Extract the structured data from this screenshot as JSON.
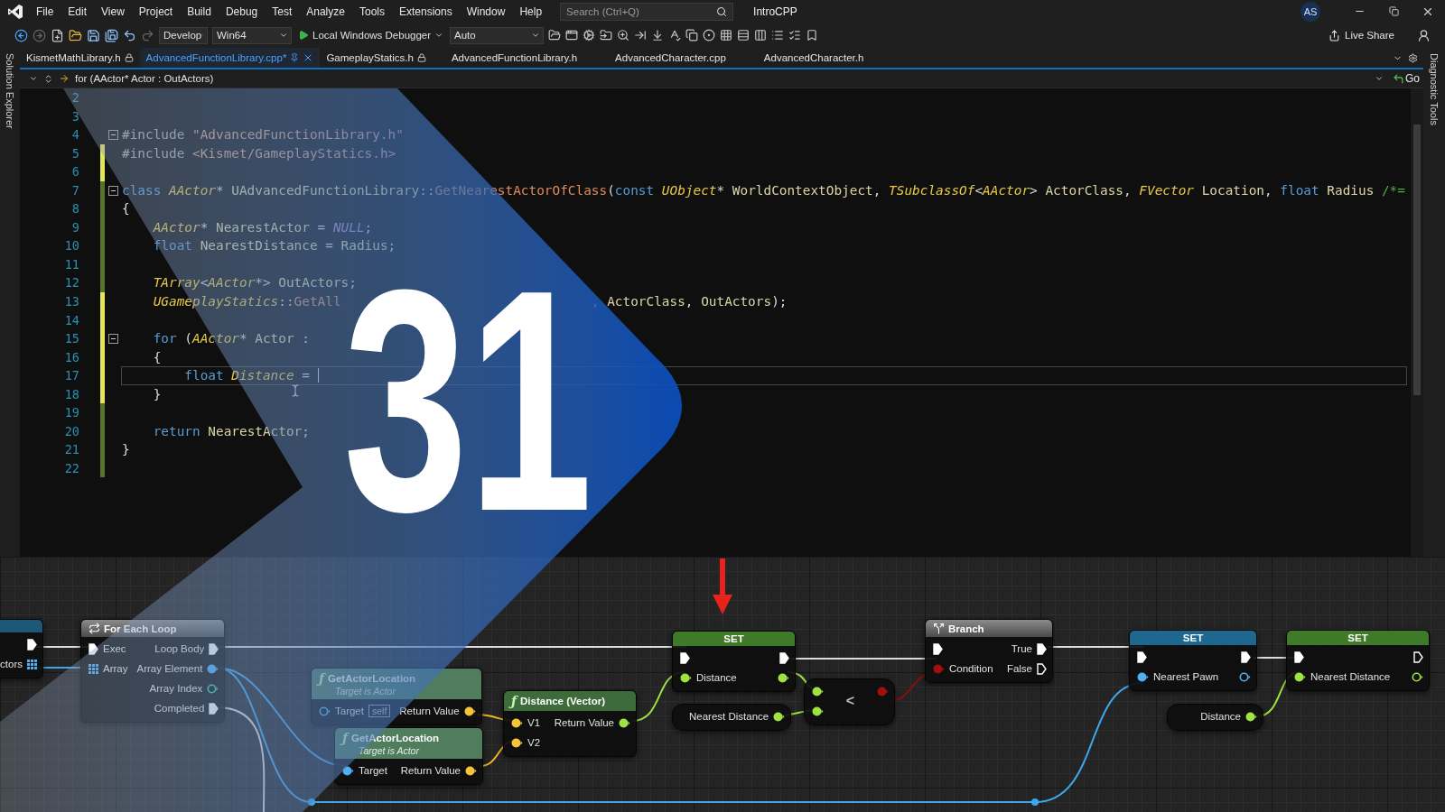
{
  "menu": [
    "File",
    "Edit",
    "View",
    "Project",
    "Build",
    "Debug",
    "Test",
    "Analyze",
    "Tools",
    "Extensions",
    "Window",
    "Help"
  ],
  "search": {
    "placeholder": "Search (Ctrl+Q)"
  },
  "solution_name": "IntroCPP",
  "user_initials": "AS",
  "toolbar": {
    "configuration": "Develop",
    "platform": "Win64",
    "debugger": "Local Windows Debugger",
    "target": "Auto",
    "live_share": "Live Share"
  },
  "side_panels": {
    "left": "Solution Explorer",
    "right": "Diagnostic Tools"
  },
  "tabs": [
    {
      "label": "KismetMathLibrary.h",
      "selected": false,
      "read_only": true
    },
    {
      "label": "AdvancedFunctionLibrary.cpp*",
      "selected": true,
      "read_only": false
    },
    {
      "label": "GameplayStatics.h",
      "selected": false,
      "read_only": true
    },
    {
      "label": "AdvancedFunctionLibrary.h",
      "selected": false,
      "read_only": false
    },
    {
      "label": "AdvancedCharacter.cpp",
      "selected": false,
      "read_only": false
    },
    {
      "label": "AdvancedCharacter.h",
      "selected": false,
      "read_only": false
    }
  ],
  "navigation": {
    "scope": "for (AActor* Actor : OutActors)",
    "go": "Go"
  },
  "code": {
    "lines": [
      {
        "number": "2",
        "kind": "unchanged",
        "fold_marker": false,
        "current": false
      },
      {
        "number": "3",
        "kind": "unchanged",
        "fold_marker": false,
        "current": false
      },
      {
        "number": "4",
        "kind": "unchanged",
        "fold_marker": true,
        "current": false,
        "segments": [
          {
            "text": "#include ",
            "kind": "preproc"
          },
          {
            "text": "\"AdvancedFunctionLibrary.h\"",
            "kind": "string"
          }
        ]
      },
      {
        "number": "5",
        "kind": "unsaved",
        "fold_marker": false,
        "current": false,
        "segments": [
          {
            "text": "#include ",
            "kind": "preproc"
          },
          {
            "text": "<Kismet/GameplayStatics.h>",
            "kind": "string"
          }
        ]
      },
      {
        "number": "6",
        "kind": "unsaved",
        "fold_marker": false,
        "current": false
      },
      {
        "number": "7",
        "kind": "saved",
        "fold_marker": true,
        "current": false,
        "segments": [
          {
            "text": "class ",
            "kind": "keyword"
          },
          {
            "text": "AActor",
            "kind": "type"
          },
          {
            "text": "* ",
            "kind": "plain"
          },
          {
            "text": "UAdvancedFunctionLibrary",
            "kind": "ident"
          },
          {
            "text": "::",
            "kind": "plain"
          },
          {
            "text": "GetNearestActorOfClass",
            "kind": "func"
          },
          {
            "text": "(",
            "kind": "plain"
          },
          {
            "text": "const ",
            "kind": "keyword"
          },
          {
            "text": "UObject",
            "kind": "type"
          },
          {
            "text": "* ",
            "kind": "plain"
          },
          {
            "text": "WorldContextObject",
            "kind": "ident"
          },
          {
            "text": ", ",
            "kind": "plain"
          },
          {
            "text": "TSubclassOf",
            "kind": "type"
          },
          {
            "text": "<",
            "kind": "plain"
          },
          {
            "text": "AActor",
            "kind": "type"
          },
          {
            "text": "> ",
            "kind": "plain"
          },
          {
            "text": "ActorClass",
            "kind": "ident"
          },
          {
            "text": ", ",
            "kind": "plain"
          },
          {
            "text": "FVector",
            "kind": "type"
          },
          {
            "text": " Location",
            "kind": "ident"
          },
          {
            "text": ", ",
            "kind": "plain"
          },
          {
            "text": "float ",
            "kind": "keyword"
          },
          {
            "text": "Radius",
            "kind": "ident"
          },
          {
            "text": " /*=",
            "kind": "comment"
          }
        ]
      },
      {
        "number": "8",
        "kind": "saved",
        "fold_marker": false,
        "current": false,
        "segments": [
          {
            "text": "{",
            "kind": "plain"
          }
        ]
      },
      {
        "number": "9",
        "kind": "saved",
        "fold_marker": false,
        "current": false,
        "segments": [
          {
            "text": "    AActor",
            "kind": "type"
          },
          {
            "text": "* ",
            "kind": "plain"
          },
          {
            "text": "NearestActor",
            "kind": "ident"
          },
          {
            "text": " = ",
            "kind": "plain"
          },
          {
            "text": "NULL",
            "kind": "macro"
          },
          {
            "text": ";",
            "kind": "plain"
          }
        ]
      },
      {
        "number": "10",
        "kind": "saved",
        "fold_marker": false,
        "current": false,
        "segments": [
          {
            "text": "    float ",
            "kind": "keyword"
          },
          {
            "text": "NearestDistance",
            "kind": "ident"
          },
          {
            "text": " = ",
            "kind": "plain"
          },
          {
            "text": "Radius",
            "kind": "ident"
          },
          {
            "text": ";",
            "kind": "plain"
          }
        ]
      },
      {
        "number": "11",
        "kind": "saved",
        "fold_marker": false,
        "current": false
      },
      {
        "number": "12",
        "kind": "saved",
        "fold_marker": false,
        "current": false,
        "segments": [
          {
            "text": "    TArray",
            "kind": "type"
          },
          {
            "text": "<",
            "kind": "plain"
          },
          {
            "text": "AActor",
            "kind": "type"
          },
          {
            "text": "*> ",
            "kind": "plain"
          },
          {
            "text": "OutActors",
            "kind": "ident"
          },
          {
            "text": ";",
            "kind": "plain"
          }
        ]
      },
      {
        "number": "13",
        "kind": "unsaved",
        "fold_marker": false,
        "current": false,
        "segments": [
          {
            "text": "    UGameplayStatics",
            "kind": "type"
          },
          {
            "text": "::",
            "kind": "plain"
          },
          {
            "text": "GetAll",
            "kind": "func"
          },
          {
            "text": "                                , ",
            "kind": "plain"
          },
          {
            "text": "ActorClass",
            "kind": "ident"
          },
          {
            "text": ", ",
            "kind": "plain"
          },
          {
            "text": "OutActors",
            "kind": "ident"
          },
          {
            "text": ");",
            "kind": "plain"
          }
        ]
      },
      {
        "number": "14",
        "kind": "unsaved",
        "fold_marker": false,
        "current": false
      },
      {
        "number": "15",
        "kind": "unsaved",
        "fold_marker": true,
        "current": false,
        "segments": [
          {
            "text": "    for",
            "kind": "keyword"
          },
          {
            "text": " (",
            "kind": "plain"
          },
          {
            "text": "AActor",
            "kind": "type"
          },
          {
            "text": "* ",
            "kind": "plain"
          },
          {
            "text": "Actor",
            "kind": "ident"
          },
          {
            "text": " :",
            "kind": "plain"
          }
        ]
      },
      {
        "number": "16",
        "kind": "unsaved",
        "fold_marker": false,
        "current": false,
        "segments": [
          {
            "text": "    {",
            "kind": "plain"
          }
        ]
      },
      {
        "number": "17",
        "kind": "unsaved",
        "fold_marker": false,
        "current": true,
        "segments": [
          {
            "text": "        float ",
            "kind": "keyword"
          },
          {
            "text": "Distance",
            "kind": "local"
          },
          {
            "text": " = ",
            "kind": "plain"
          }
        ]
      },
      {
        "number": "18",
        "kind": "unsaved",
        "fold_marker": false,
        "current": false,
        "segments": [
          {
            "text": "    }",
            "kind": "plain"
          }
        ]
      },
      {
        "number": "19",
        "kind": "saved",
        "fold_marker": false,
        "current": false
      },
      {
        "number": "20",
        "kind": "saved",
        "fold_marker": false,
        "current": false,
        "segments": [
          {
            "text": "    return ",
            "kind": "keyword"
          },
          {
            "text": "NearestActor",
            "kind": "ident"
          },
          {
            "text": ";",
            "kind": "plain"
          }
        ]
      },
      {
        "number": "21",
        "kind": "saved",
        "fold_marker": false,
        "current": false,
        "segments": [
          {
            "text": "}",
            "kind": "plain"
          }
        ]
      },
      {
        "number": "22",
        "kind": "saved",
        "fold_marker": false,
        "current": false
      }
    ]
  },
  "overlay": {
    "number": "31"
  },
  "blueprint": {
    "nodes": [
      {
        "kind": "partial",
        "color": "#1d5878",
        "outputs": [
          {
            "kind": "exec",
            "connected": true
          },
          {
            "label": "ctors",
            "kind": "array",
            "connected": true
          }
        ]
      },
      {
        "kind": "loop",
        "title": "For Each Loop",
        "inputs": [
          {
            "label": "Exec",
            "kind": "exec",
            "connected": true
          },
          {
            "label": "Array",
            "kind": "array",
            "connected": true
          }
        ],
        "outputs": [
          {
            "label": "Loop Body",
            "kind": "exec",
            "connected": true
          },
          {
            "label": "Array Element",
            "kind": "object",
            "connected": true
          },
          {
            "label": "Array Index",
            "kind": "int",
            "connected": false
          },
          {
            "label": "Completed",
            "kind": "exec",
            "connected": true
          }
        ]
      },
      {
        "kind": "function",
        "icon": "ƒ",
        "title": "GetActorLocation",
        "subtitle": "Target is Actor",
        "color": "#4f7d5e",
        "inputs": [
          {
            "label": "Target",
            "kind": "object",
            "connected": false,
            "default": "self"
          }
        ],
        "outputs": [
          {
            "label": "Return Value",
            "kind": "vector",
            "connected": true
          }
        ]
      },
      {
        "kind": "function",
        "icon": "ƒ",
        "title": "GetActorLocation",
        "subtitle": "Target is Actor",
        "color": "#4f7d5e",
        "inputs": [
          {
            "label": "Target",
            "kind": "object",
            "connected": true
          }
        ],
        "outputs": [
          {
            "label": "Return Value",
            "kind": "vector",
            "connected": true
          }
        ]
      },
      {
        "kind": "function",
        "icon": "ƒ",
        "title": "Distance (Vector)",
        "color": "#3e6b3a",
        "inputs": [
          {
            "label": "V1",
            "kind": "vector",
            "connected": true
          },
          {
            "label": "V2",
            "kind": "vector",
            "connected": true
          }
        ],
        "outputs": [
          {
            "label": "Return Value",
            "kind": "float",
            "connected": true
          }
        ]
      },
      {
        "kind": "set",
        "title": "SET",
        "color": "#3f7a28",
        "inputs": [
          {
            "kind": "exec",
            "connected": true
          },
          {
            "label": "Distance",
            "kind": "float",
            "connected": true
          }
        ],
        "outputs": [
          {
            "kind": "exec",
            "connected": true
          },
          {
            "kind": "float",
            "connected": true
          }
        ]
      },
      {
        "kind": "getter",
        "outputs": [
          {
            "label": "Nearest Distance",
            "kind": "float",
            "connected": true
          }
        ]
      },
      {
        "kind": "operator",
        "symbol": "<",
        "inputs": [
          {
            "kind": "float",
            "connected": true
          },
          {
            "kind": "float",
            "connected": true
          }
        ],
        "outputs": [
          {
            "kind": "bool",
            "connected": true
          }
        ]
      },
      {
        "kind": "branch",
        "title": "Branch",
        "inputs": [
          {
            "kind": "exec",
            "connected": true
          },
          {
            "label": "Condition",
            "kind": "bool",
            "connected": true
          }
        ],
        "outputs": [
          {
            "label": "True",
            "kind": "exec",
            "connected": true
          },
          {
            "label": "False",
            "kind": "exec",
            "connected": false
          }
        ]
      },
      {
        "kind": "set",
        "title": "SET",
        "color": "#1e6890",
        "inputs": [
          {
            "kind": "exec",
            "connected": true
          },
          {
            "label": "Nearest Pawn",
            "kind": "object",
            "connected": true
          }
        ],
        "outputs": [
          {
            "kind": "exec",
            "connected": true
          },
          {
            "kind": "object",
            "connected": false
          }
        ]
      },
      {
        "kind": "set",
        "title": "SET",
        "color": "#3f7a28",
        "inputs": [
          {
            "kind": "exec",
            "connected": true
          },
          {
            "label": "Nearest Distance",
            "kind": "float",
            "connected": true
          }
        ],
        "outputs": [
          {
            "kind": "exec",
            "connected": false
          },
          {
            "kind": "float",
            "connected": false
          }
        ]
      },
      {
        "kind": "getter",
        "outputs": [
          {
            "label": "Distance",
            "kind": "float",
            "connected": true
          }
        ]
      }
    ]
  }
}
